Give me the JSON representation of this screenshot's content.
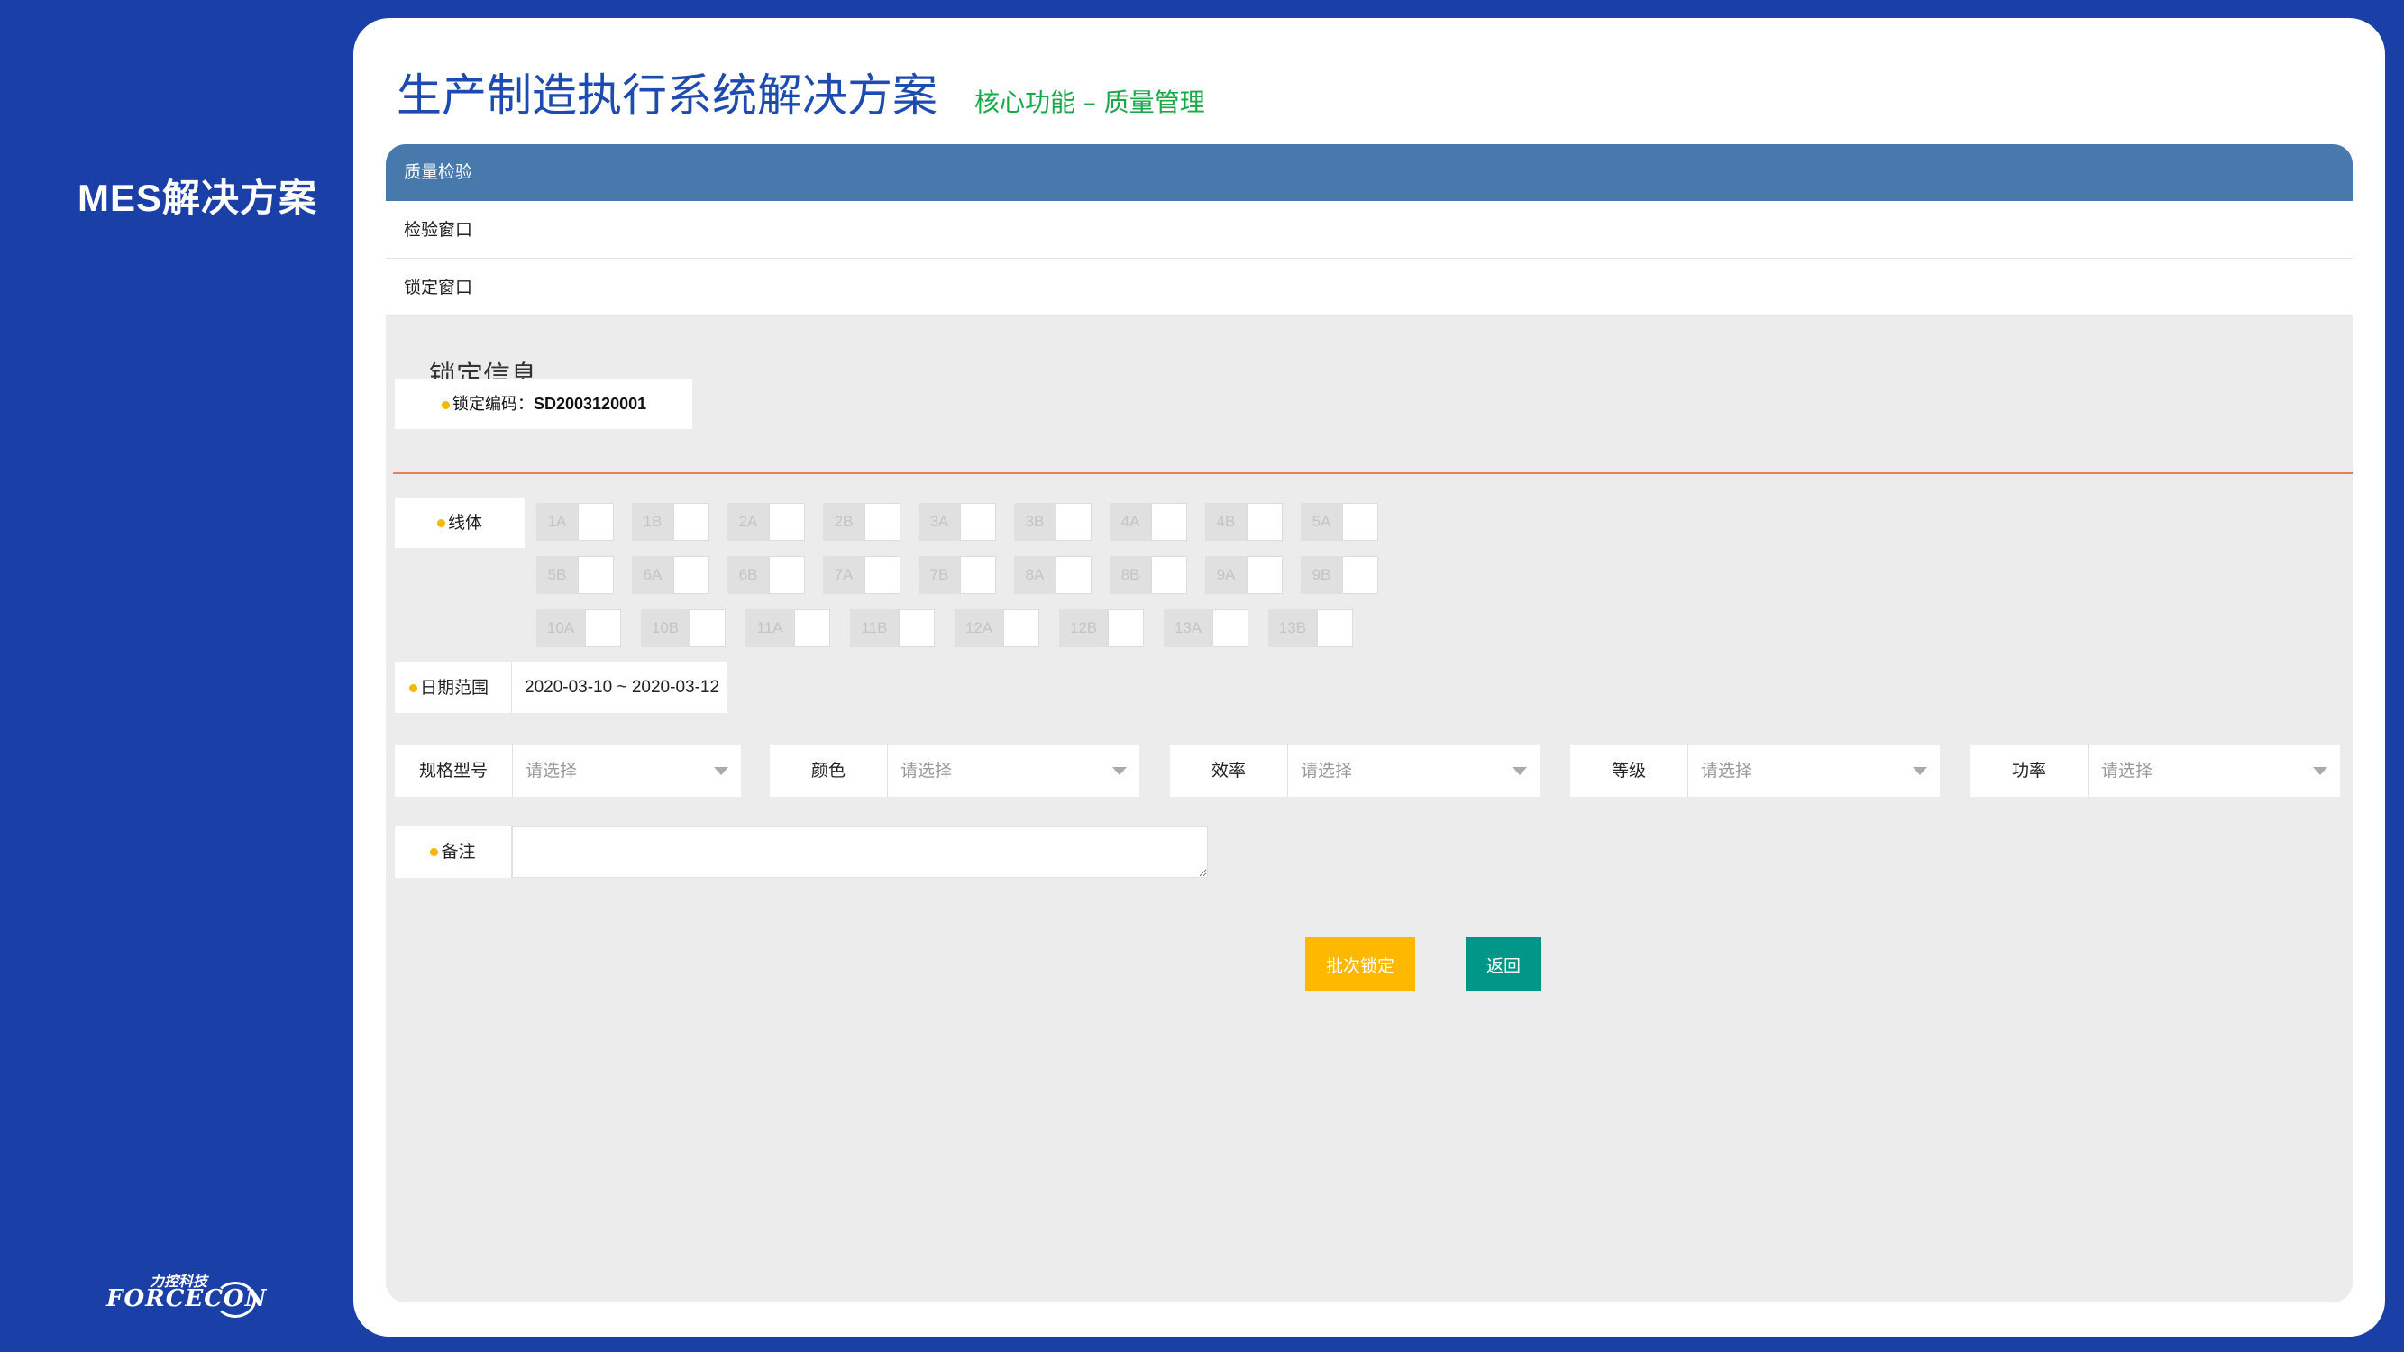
{
  "brand": {
    "title": "MES解决方案",
    "logo_cn": "力控科技",
    "logo_en": "FORCECON"
  },
  "header": {
    "title": "生产制造执行系统解决方案",
    "subtitle": "核心功能 – 质量管理"
  },
  "nav": {
    "header": "质量检验",
    "items": [
      "检验窗口",
      "锁定窗口"
    ]
  },
  "lock_info": {
    "section_title": "锁定信息",
    "code_label": "锁定编码：",
    "code_value": "SD2003120001"
  },
  "line_body": {
    "label": "线体",
    "rows": [
      [
        "1A",
        "1B",
        "2A",
        "2B",
        "3A",
        "3B",
        "4A",
        "4B",
        "5A"
      ],
      [
        "5B",
        "6A",
        "6B",
        "7A",
        "7B",
        "8A",
        "8B",
        "9A",
        "9B"
      ],
      [
        "10A",
        "10B",
        "11A",
        "11B",
        "12A",
        "12B",
        "13A",
        "13B"
      ]
    ]
  },
  "date_range": {
    "label": "日期范围",
    "value": "2020-03-10 ~ 2020-03-12"
  },
  "selects": [
    {
      "label": "规格型号",
      "placeholder": "请选择"
    },
    {
      "label": "颜色",
      "placeholder": "请选择"
    },
    {
      "label": "效率",
      "placeholder": "请选择"
    },
    {
      "label": "等级",
      "placeholder": "请选择"
    },
    {
      "label": "功率",
      "placeholder": "请选择"
    }
  ],
  "remark": {
    "label": "备注",
    "value": ""
  },
  "buttons": {
    "batch_lock": "批次锁定",
    "back": "返回"
  },
  "colors": {
    "background": "#1a3fa6",
    "nav_header": "#4779ad",
    "accent_yellow": "#ffb800",
    "accent_teal": "#009688",
    "title_blue": "#1d4bb0",
    "subtitle_green": "#19a84a",
    "rule_orange": "#ef7b52"
  }
}
